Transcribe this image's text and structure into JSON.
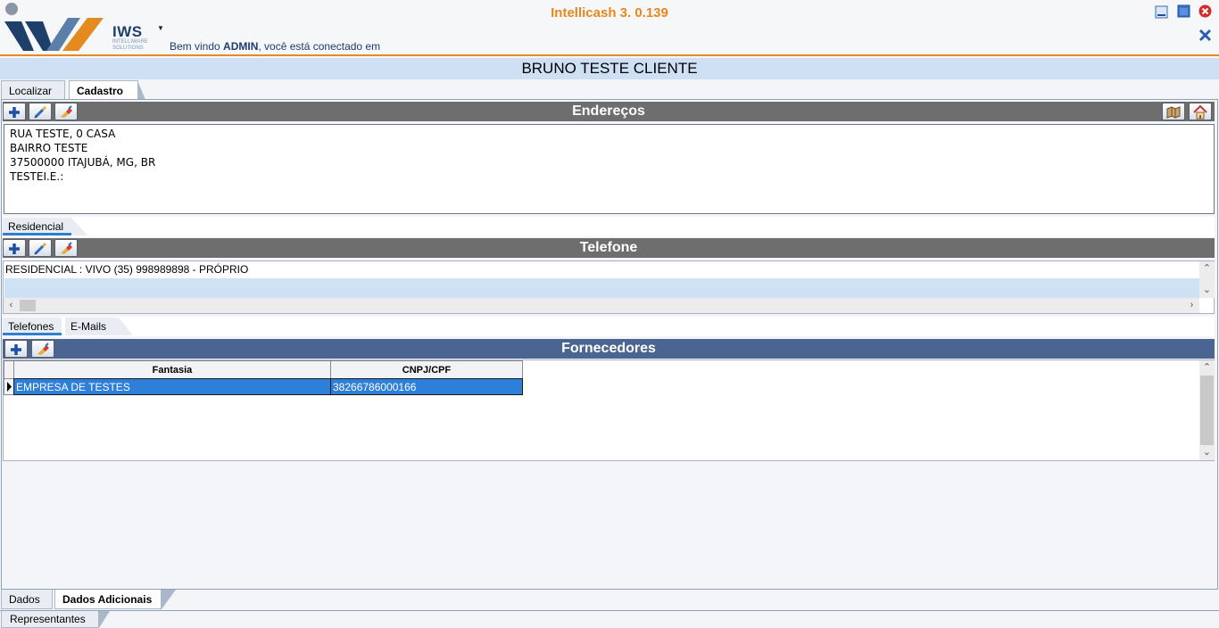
{
  "header": {
    "app_title": "Intellicash 3. 0.139",
    "logo_text": "IWS",
    "logo_subtext_1": "INTELLIWARE",
    "logo_subtext_2": "SOLUTIONS",
    "welcome_prefix": "Bem vindo ",
    "welcome_user": "ADMIN",
    "welcome_suffix": ", você está conectado em"
  },
  "client": {
    "name": "BRUNO TESTE CLIENTE"
  },
  "top_tabs": [
    {
      "label": "Localizar",
      "active": false
    },
    {
      "label": "Cadastro",
      "active": true
    }
  ],
  "enderecos": {
    "title": "Endereços",
    "lines": [
      "RUA TESTE, 0 CASA",
      "BAIRRO TESTE",
      "37500000 ITAJUBÁ, MG, BR",
      "TESTEI.E.:"
    ],
    "subtabs": [
      {
        "label": "Residencial",
        "active": true
      }
    ]
  },
  "telefone": {
    "title": "Telefone",
    "rows": [
      "RESIDENCIAL : VIVO (35) 998989898 - PRÓPRIO"
    ],
    "subtabs": [
      {
        "label": "Telefones",
        "active": true
      },
      {
        "label": "E-Mails",
        "active": false
      }
    ]
  },
  "fornecedores": {
    "title": "Fornecedores",
    "columns": [
      "Fantasia",
      "CNPJ/CPF"
    ],
    "rows": [
      {
        "fantasia": "EMPRESA DE TESTES",
        "cnpj": "38266786000166"
      }
    ]
  },
  "bottom_tabs": [
    {
      "label": "Dados",
      "active": false
    },
    {
      "label": "Dados Adicionais",
      "active": true
    }
  ],
  "footer_tab": {
    "label": "Representantes"
  },
  "colors": {
    "accent_orange": "#e8871c",
    "section_gray": "#6e6e6e",
    "section_blue": "#4a6592",
    "selection_blue": "#2e7fd9"
  },
  "icons": [
    "plus-icon",
    "edit-icon",
    "eraser-icon",
    "map-icon",
    "home-icon",
    "minimize-icon",
    "maximize-icon",
    "close-icon"
  ]
}
